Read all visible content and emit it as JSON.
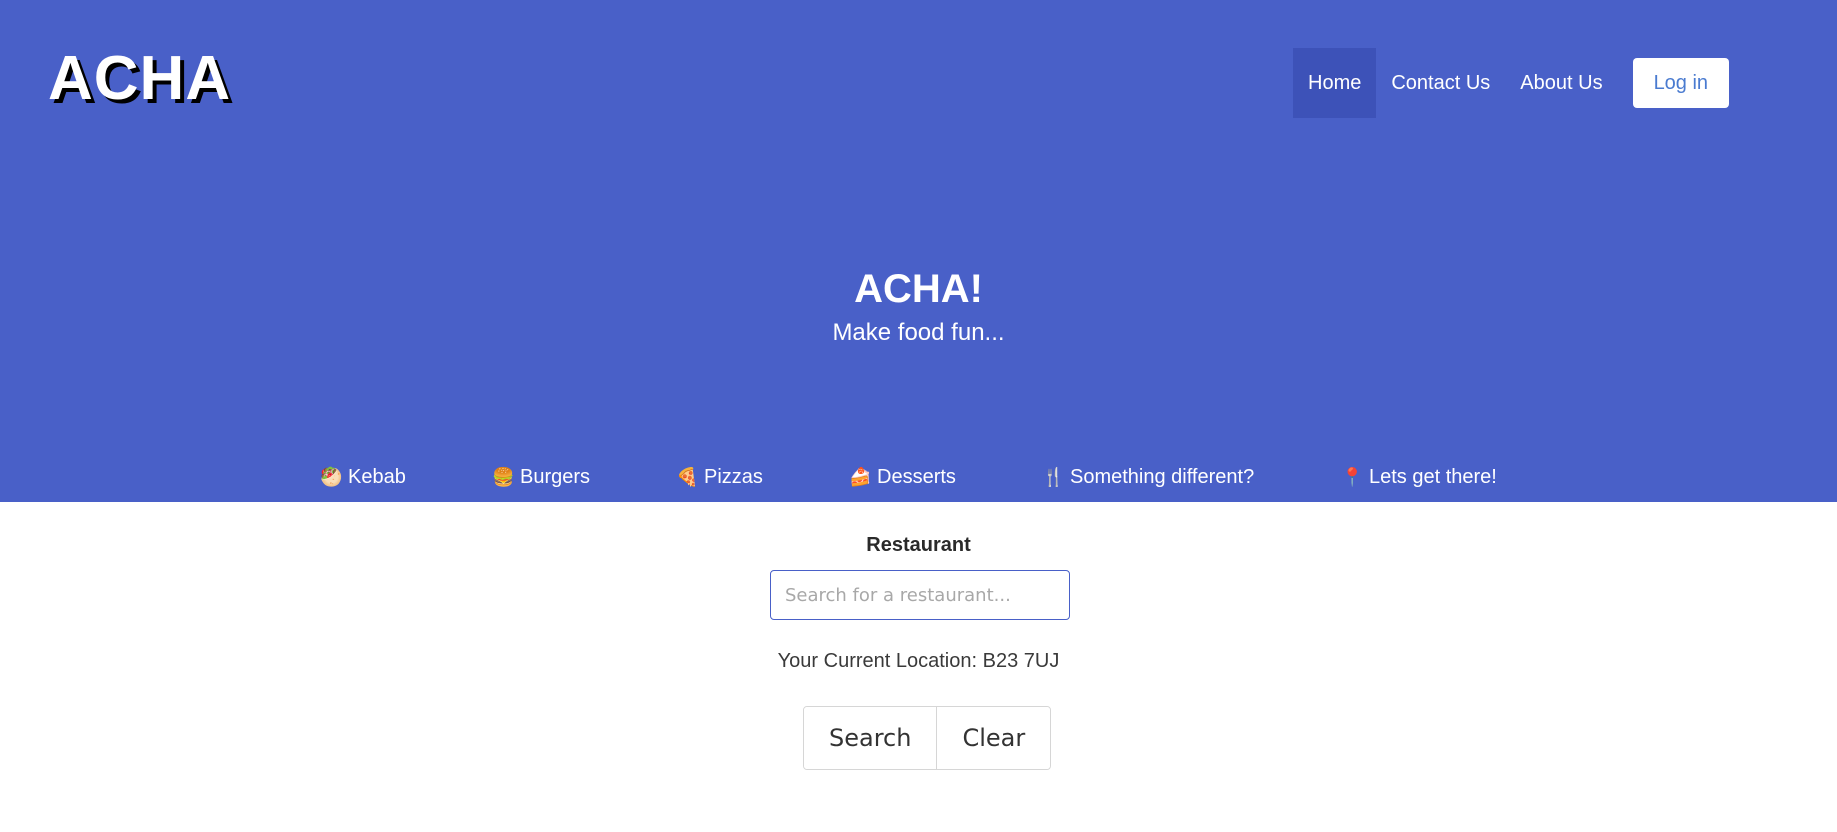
{
  "brand": {
    "logo": "ACHA"
  },
  "nav": {
    "items": [
      {
        "label": "Home",
        "active": true
      },
      {
        "label": "Contact Us",
        "active": false
      },
      {
        "label": "About Us",
        "active": false
      }
    ],
    "login_label": "Log in"
  },
  "hero": {
    "title": "ACHA!",
    "subtitle": "Make food fun..."
  },
  "categories": [
    {
      "label": "Kebab",
      "icon": "kebab-icon",
      "glyph": "🥙"
    },
    {
      "label": "Burgers",
      "icon": "burger-icon",
      "glyph": "🍔"
    },
    {
      "label": "Pizzas",
      "icon": "pizza-icon",
      "glyph": "🍕"
    },
    {
      "label": "Desserts",
      "icon": "cake-icon",
      "glyph": "🍰"
    },
    {
      "label": "Something different?",
      "icon": "fork-knife-icon",
      "glyph": "🍴"
    },
    {
      "label": "Lets get there!",
      "icon": "pin-icon",
      "glyph": "📍"
    }
  ],
  "search": {
    "label": "Restaurant",
    "placeholder": "Search for a restaurant...",
    "value": "",
    "location_text": "Your Current Location: B23 7UJ",
    "search_label": "Search",
    "clear_label": "Clear"
  },
  "colors": {
    "primary": "#4960c8",
    "active_nav": "#3d52b8",
    "login_text": "#4a7bd0"
  }
}
